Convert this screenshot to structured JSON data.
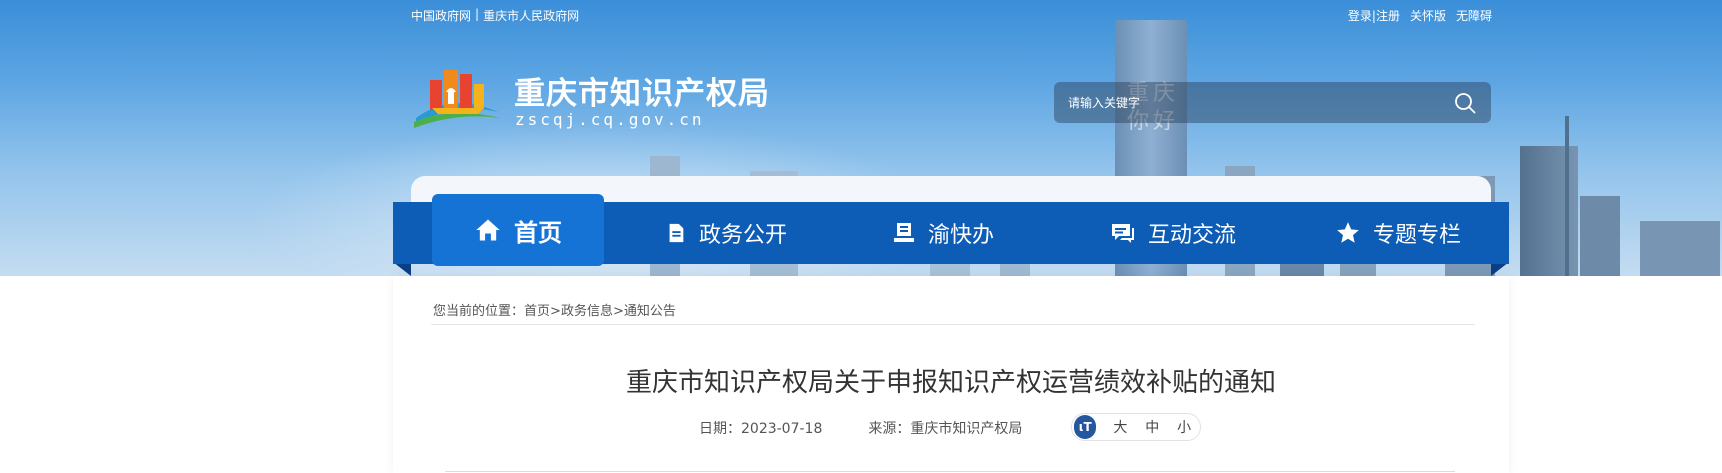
{
  "top_links": {
    "left": [
      "中国政府网",
      "|",
      "重庆市人民政府网"
    ],
    "right": [
      "登录|注册",
      "关怀版",
      "无障碍"
    ]
  },
  "banner": {
    "tower_text": "重庆你好"
  },
  "site": {
    "title": "重庆市知识产权局",
    "domain": "zscqj.cq.gov.cn"
  },
  "search": {
    "placeholder": "请输入关键字",
    "icon": "search-icon"
  },
  "nav": {
    "items": [
      {
        "label": "首页",
        "icon": "home-icon",
        "active": true
      },
      {
        "label": "政务公开",
        "icon": "document-icon",
        "active": false
      },
      {
        "label": "渝快办",
        "icon": "desk-icon",
        "active": false
      },
      {
        "label": "互动交流",
        "icon": "chat-icon",
        "active": false
      },
      {
        "label": "专题专栏",
        "icon": "star-icon",
        "active": false
      }
    ]
  },
  "breadcrumb": {
    "prefix": "您当前的位置：",
    "items": [
      "首页",
      "政务信息",
      "通知公告"
    ],
    "separator": ">"
  },
  "article": {
    "title": "重庆市知识产权局关于申报知识产权运营绩效补贴的通知",
    "date_label": "日期：2023-07-18",
    "source_label": "来源：重庆市知识产权局"
  },
  "font_size": {
    "icon_glyph": "ιT",
    "options": [
      "大",
      "中",
      "小"
    ]
  },
  "colors": {
    "nav_bg": "#0d5cb6",
    "nav_active": "#1673d6",
    "font_icon": "#24579f"
  }
}
